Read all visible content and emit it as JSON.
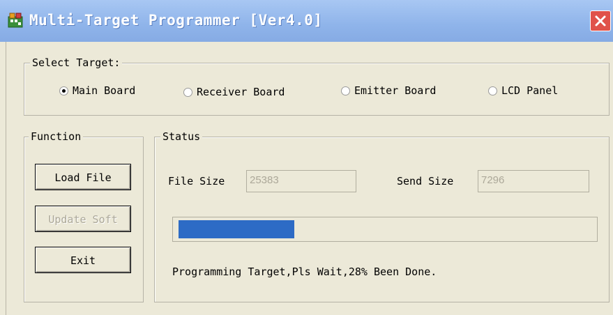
{
  "window": {
    "title": "Multi-Target Programmer [Ver4.0]",
    "close_glyph": "✕"
  },
  "select_target": {
    "legend": "Select Target:",
    "options": [
      {
        "label": "Main Board",
        "checked": true
      },
      {
        "label": "Receiver Board",
        "checked": false
      },
      {
        "label": "Emitter Board",
        "checked": false
      },
      {
        "label": "LCD Panel",
        "checked": false
      }
    ]
  },
  "function": {
    "legend": "Function",
    "buttons": {
      "load": "Load File",
      "update": "Update Soft",
      "exit": "Exit"
    }
  },
  "status": {
    "legend": "Status",
    "file_size_label": "File Size",
    "file_size_value": "25383",
    "send_size_label": "Send Size",
    "send_size_value": "7296",
    "progress_percent": 28,
    "message": "Programming Target,Pls Wait,28% Been Done."
  },
  "colors": {
    "titlebar": "#8fb4ea",
    "close": "#e0524a",
    "progress": "#2d6bc5"
  }
}
